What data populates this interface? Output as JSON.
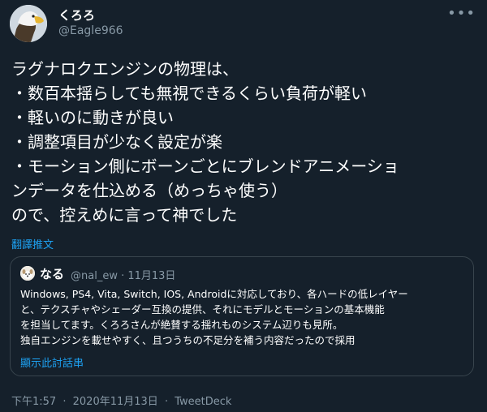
{
  "user": {
    "name": "くろろ",
    "handle": "@Eagle966"
  },
  "menu": {
    "more_glyph": "•••"
  },
  "tweet": {
    "lines": [
      "ラグナロクエンジンの物理は、",
      "・数百本揺らしても無視できるくらい負荷が軽い",
      "・軽いのに動きが良い",
      "・調整項目が少なく設定が楽",
      "・モーション側にボーンごとにブレンドアニメーショ",
      "ンデータを仕込める（めっちゃ使う）",
      "ので、控えめに言って神でした"
    ],
    "translate_label": "翻譯推文"
  },
  "quote": {
    "name": "なる",
    "meta": "@nal_ew · 11月13日",
    "lines": [
      "Windows, PS4, Vita, Switch, IOS, Androidに対応しており、各ハードの低レイヤー",
      "と、テクスチャやシェーダー互換の提供、それにモデルとモーションの基本機能",
      "を担当してます。くろろさんが絶賛する揺れものシステム辺りも見所。",
      "独自エンジンを載せやすく、且つうちの不足分を補う内容だったので採用"
    ],
    "thread_label": "顯示此討話串"
  },
  "footer": {
    "time": "下午1:57",
    "sep1": "·",
    "date": "2020年11月13日",
    "sep2": "·",
    "source": "TweetDeck"
  }
}
